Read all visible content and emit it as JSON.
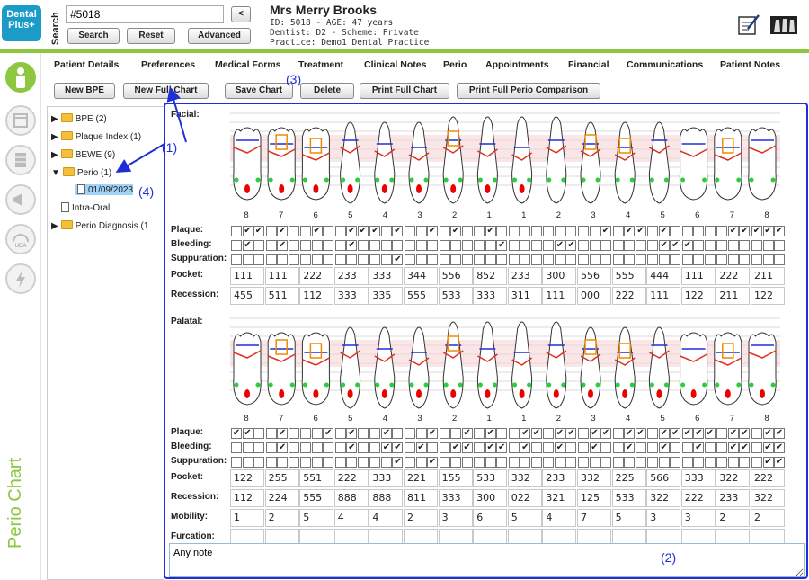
{
  "app": {
    "logo_line1": "Dental",
    "logo_line2": "Plus+"
  },
  "search": {
    "label": "Search",
    "value": "#5018",
    "search_btn": "Search",
    "reset_btn": "Reset",
    "advanced_btn": "Advanced",
    "prev_btn": "<"
  },
  "patient": {
    "name": "Mrs Merry Brooks",
    "line1": "ID: 5018 - AGE: 47 years",
    "line2": "Dentist: D2 - Scheme: Private",
    "line3": "Practice: Demo1 Dental Practice"
  },
  "sidebar": {
    "vertical_label": "Perio Chart"
  },
  "menu": [
    "Patient Details",
    "Preferences",
    "Medical Forms",
    "Treatment",
    "Clinical Notes",
    "Perio",
    "Appointments",
    "Financial",
    "Communications",
    "Patient Notes"
  ],
  "toolbar": [
    "New BPE",
    "New Full Chart",
    "Save Chart",
    "Delete",
    "Print Full Chart",
    "Print Full Perio Comparison"
  ],
  "tree": [
    {
      "label": "BPE (2)",
      "type": "folder",
      "exp": "▶"
    },
    {
      "label": "Plaque Index (1)",
      "type": "folder",
      "exp": "▶"
    },
    {
      "label": "BEWE (9)",
      "type": "folder",
      "exp": "▶"
    },
    {
      "label": "Perio (1)",
      "type": "folder",
      "exp": "▼"
    },
    {
      "label": "01/09/2023",
      "type": "doc",
      "exp": ""
    },
    {
      "label": "Intra-Oral",
      "type": "doc",
      "exp": ""
    },
    {
      "label": "Perio Diagnosis (1",
      "type": "folder",
      "exp": "▶"
    }
  ],
  "annotations": [
    "(1)",
    "(2)",
    "(3)",
    "(4)"
  ],
  "chart": {
    "facial_label": "Facial:",
    "palatal_label": "Palatal:",
    "tooth_numbers": [
      "8",
      "7",
      "6",
      "5",
      "4",
      "3",
      "2",
      "1",
      "1",
      "2",
      "3",
      "4",
      "5",
      "6",
      "7",
      "8"
    ],
    "row_labels": {
      "plaque": "Plaque:",
      "bleeding": "Bleeding:",
      "suppuration": "Suppuration:",
      "pocket": "Pocket:",
      "recession": "Recession:",
      "mobility": "Mobility:",
      "furcation": "Furcation:"
    },
    "facial": {
      "plaque": [
        "011",
        "010",
        "010",
        "011",
        "101",
        "001",
        "010",
        "010",
        "000",
        "000",
        "001",
        "011",
        "010",
        "000",
        "011",
        "111"
      ],
      "bleeding": [
        "010",
        "010",
        "000",
        "010",
        "000",
        "000",
        "000",
        "001",
        "000",
        "011",
        "000",
        "000",
        "011",
        "100",
        "000",
        "000"
      ],
      "suppuration": [
        "000",
        "000",
        "000",
        "000",
        "001",
        "000",
        "000",
        "000",
        "000",
        "000",
        "000",
        "000",
        "000",
        "000",
        "000",
        "000"
      ],
      "pocket": [
        "111",
        "111",
        "222",
        "233",
        "333",
        "344",
        "556",
        "852",
        "233",
        "300",
        "556",
        "555",
        "444",
        "111",
        "222",
        "211"
      ],
      "recession": [
        "455",
        "511",
        "112",
        "333",
        "335",
        "555",
        "533",
        "333",
        "311",
        "111",
        "000",
        "222",
        "111",
        "122",
        "211",
        "122"
      ]
    },
    "palatal": {
      "plaque": [
        "110",
        "010",
        "001",
        "010",
        "010",
        "001",
        "001",
        "010",
        "011",
        "011",
        "011",
        "011",
        "011",
        "111",
        "011",
        "011"
      ],
      "bleeding": [
        "000",
        "010",
        "000",
        "010",
        "011",
        "010",
        "011",
        "011",
        "010",
        "010",
        "010",
        "010",
        "010",
        "010",
        "011",
        "011"
      ],
      "suppuration": [
        "000",
        "000",
        "000",
        "000",
        "001",
        "001",
        "000",
        "000",
        "000",
        "000",
        "000",
        "000",
        "000",
        "000",
        "000",
        "011"
      ],
      "pocket": [
        "122",
        "255",
        "551",
        "222",
        "333",
        "221",
        "155",
        "533",
        "332",
        "233",
        "332",
        "225",
        "566",
        "333",
        "322",
        "222"
      ],
      "recession": [
        "112",
        "224",
        "555",
        "888",
        "888",
        "811",
        "333",
        "300",
        "022",
        "321",
        "125",
        "533",
        "322",
        "222",
        "233",
        "322"
      ],
      "mobility": [
        "1",
        "2",
        "5",
        "4",
        "4",
        "2",
        "3",
        "6",
        "5",
        "4",
        "7",
        "5",
        "3",
        "3",
        "2",
        "2"
      ],
      "furcation": [
        "",
        "",
        "",
        "",
        "",
        "",
        "",
        "",
        "",
        "",
        "",
        "",
        "",
        "",
        "",
        ""
      ]
    },
    "note": "Any note"
  },
  "colors": {
    "accent": "#8dc63f",
    "annotation": "#1f2fd8",
    "selection": "#9fd3f7"
  }
}
